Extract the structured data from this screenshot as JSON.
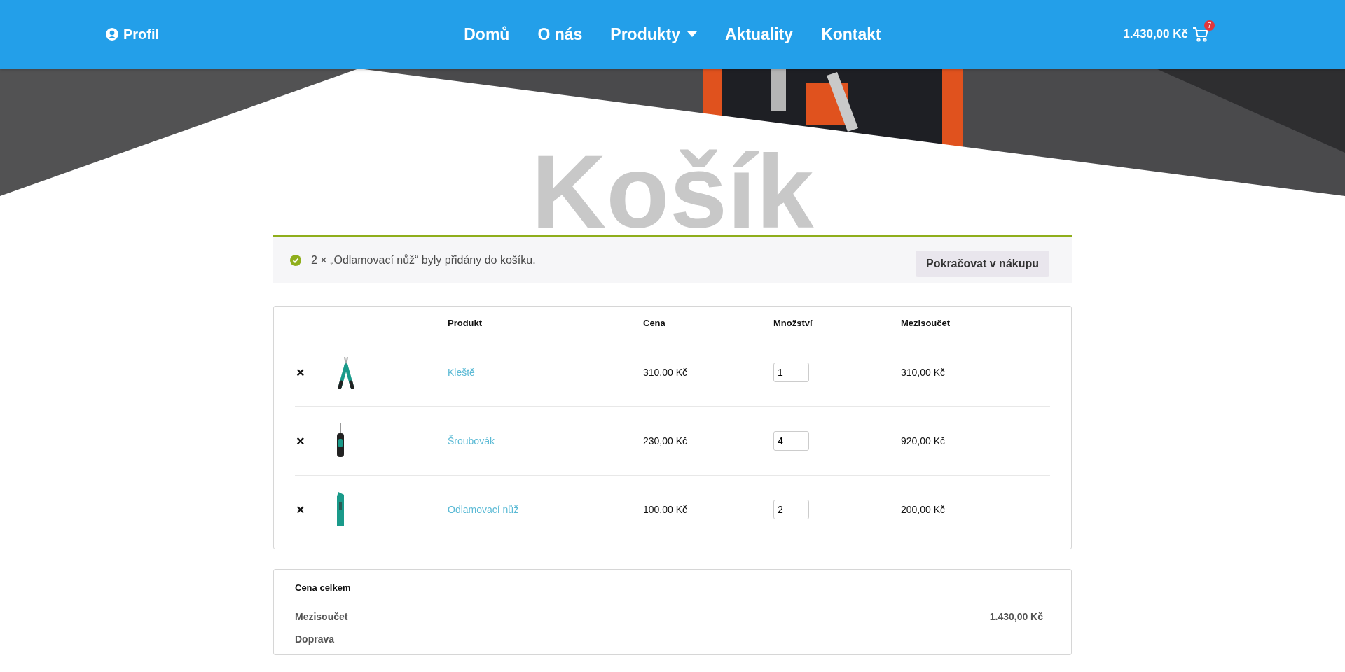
{
  "header": {
    "profile": "Profil",
    "nav": [
      {
        "label": "Domů",
        "dropdown": false
      },
      {
        "label": "O nás",
        "dropdown": false
      },
      {
        "label": "Produkty",
        "dropdown": true
      },
      {
        "label": "Aktuality",
        "dropdown": false
      },
      {
        "label": "Kontakt",
        "dropdown": false
      }
    ],
    "cart_total": "1.430,00 Kč",
    "cart_count": "7"
  },
  "page_title": "Košík",
  "notice": {
    "message": "2 × „Odlamovací nůž“ byly přidány do košíku.",
    "button": "Pokračovat v nákupu"
  },
  "cart_table": {
    "columns": [
      "Produkt",
      "Cena",
      "Množství",
      "Mezisoučet"
    ],
    "rows": [
      {
        "remove": "×",
        "product": "Kleště",
        "price": "310,00 Kč",
        "quantity": "1",
        "subtotal": "310,00 Kč"
      },
      {
        "remove": "×",
        "product": "Šroubovák",
        "price": "230,00 Kč",
        "quantity": "4",
        "subtotal": "920,00 Kč"
      },
      {
        "remove": "×",
        "product": "Odlamovací nůž",
        "price": "100,00 Kč",
        "quantity": "2",
        "subtotal": "200,00 Kč"
      }
    ]
  },
  "totals": {
    "title": "Cena celkem",
    "rows": [
      {
        "label": "Mezisoučet",
        "value": "1.430,00 Kč"
      },
      {
        "label": "Doprava"
      }
    ]
  }
}
